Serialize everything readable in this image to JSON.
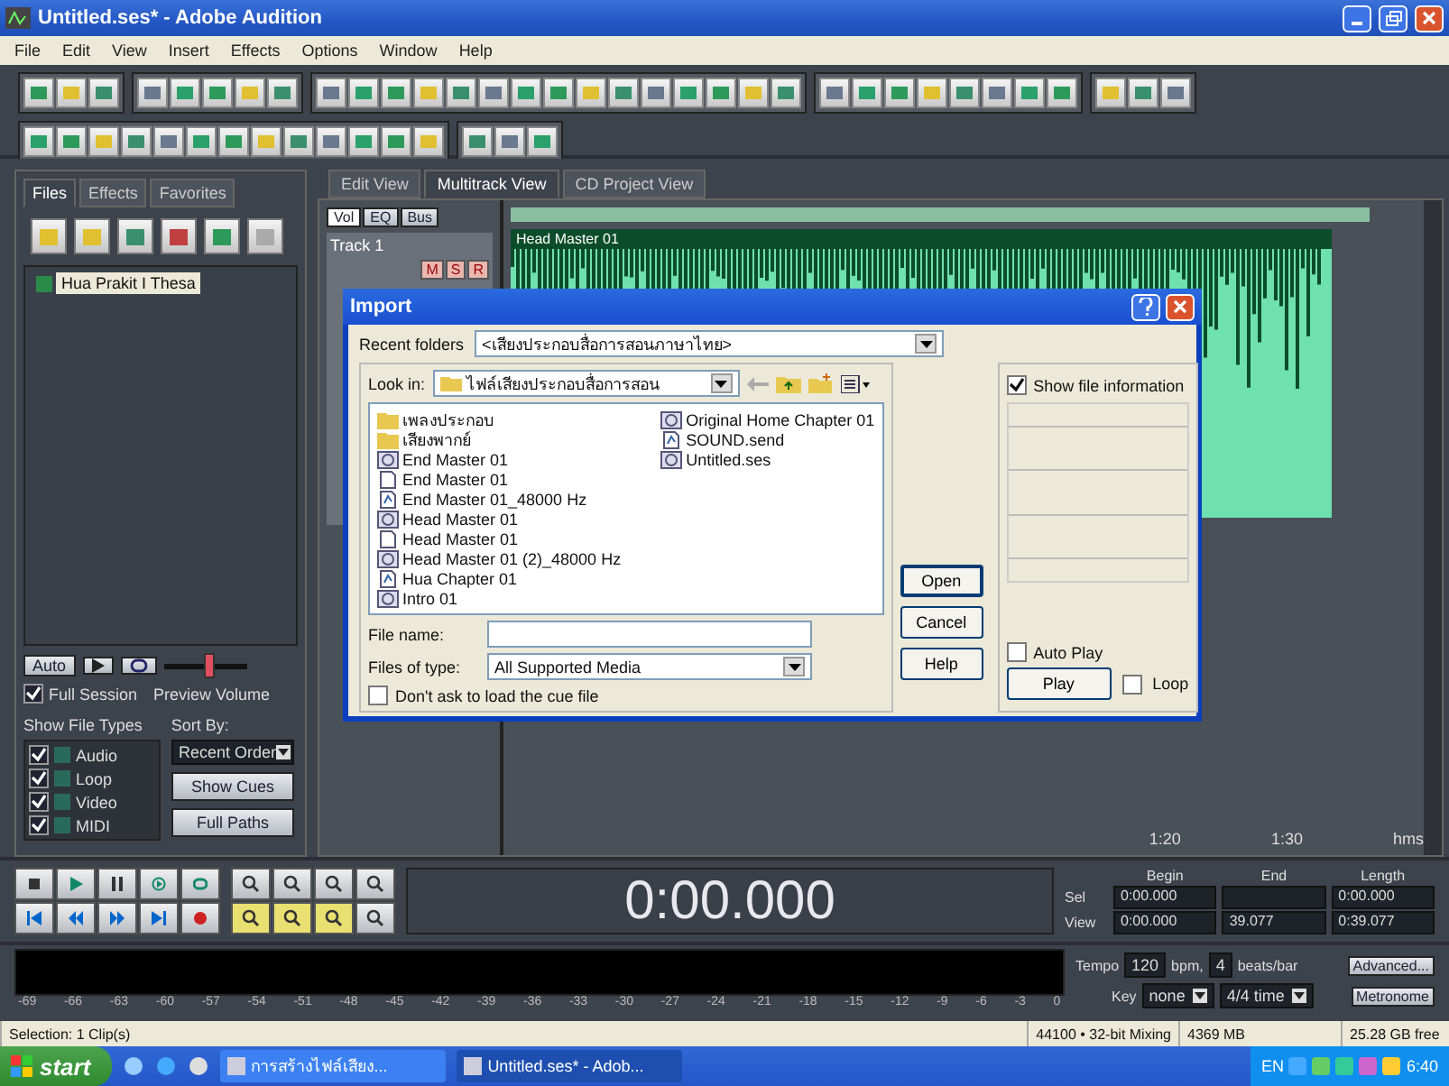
{
  "window": {
    "title": "Untitled.ses* - Adobe Audition"
  },
  "menu": [
    "File",
    "Edit",
    "View",
    "Insert",
    "Effects",
    "Options",
    "Window",
    "Help"
  ],
  "organizer": {
    "tabs": [
      {
        "label": "Files",
        "selected": true
      },
      {
        "label": "Effects",
        "selected": false
      },
      {
        "label": "Favorites",
        "selected": false
      }
    ],
    "files": [
      {
        "label": "Hua Prakit I Thesa",
        "selected": true
      }
    ],
    "auto_play": "Auto",
    "volume": {
      "level": 0.55
    },
    "full_session": {
      "label": "Full Session",
      "checked": true
    },
    "preview_volume": "Preview Volume",
    "show_file_types": "Show File Types",
    "sort_by": "Sort By:",
    "sort_value": "Recent Order",
    "file_types": [
      {
        "label": "Audio",
        "checked": true
      },
      {
        "label": "Loop",
        "checked": true
      },
      {
        "label": "Video",
        "checked": true
      },
      {
        "label": "MIDI",
        "checked": true
      }
    ],
    "buttons": [
      "Show Cues",
      "Full Paths"
    ]
  },
  "view_tabs": [
    {
      "label": "Edit View",
      "selected": false
    },
    {
      "label": "Multitrack View",
      "selected": true
    },
    {
      "label": "CD Project View",
      "selected": false
    }
  ],
  "mixer_tabs": [
    {
      "label": "Vol",
      "selected": true
    },
    {
      "label": "EQ",
      "selected": false
    },
    {
      "label": "Bus",
      "selected": false
    }
  ],
  "track": {
    "name": "Track 1",
    "buttons": [
      "M",
      "S",
      "R"
    ],
    "clip": "Head Master 01"
  },
  "ruler": [
    "1:20",
    "1:30",
    "hms"
  ],
  "dialog": {
    "title": "Import",
    "recent_label": "Recent folders",
    "recent_value": "<เสียงประกอบสื่อการสอนภาษาไทย>",
    "look_in_label": "Look in:",
    "look_in_value": "ไฟล์เสียงประกอบสื่อการสอน",
    "files": [
      {
        "name": "เพลงประกอบ",
        "kind": "folder"
      },
      {
        "name": "เสียงพากย์",
        "kind": "folder"
      },
      {
        "name": "End Master 01",
        "kind": "cd"
      },
      {
        "name": "End Master 01",
        "kind": "file"
      },
      {
        "name": "End Master 01_48000 Hz",
        "kind": "audio"
      },
      {
        "name": "Head Master 01",
        "kind": "cd"
      },
      {
        "name": "Head Master 01",
        "kind": "file"
      },
      {
        "name": "Head Master 01 (2)_48000 Hz",
        "kind": "cd"
      },
      {
        "name": "Hua Chapter 01",
        "kind": "audio"
      },
      {
        "name": "Intro 01",
        "kind": "cd"
      },
      {
        "name": "Original Home Chapter 01",
        "kind": "cd"
      },
      {
        "name": "SOUND.send",
        "kind": "audio"
      },
      {
        "name": "Untitled.ses",
        "kind": "cd"
      }
    ],
    "file_name_label": "File name:",
    "file_type_label": "Files of type:",
    "file_type_value": "All Supported Media",
    "dont_ask": {
      "label": "Don't ask to load the cue file",
      "checked": false
    },
    "buttons": [
      "Open",
      "Cancel",
      "Help"
    ],
    "show_info": {
      "label": "Show file information",
      "checked": true
    },
    "auto_play": {
      "label": "Auto Play",
      "checked": false
    },
    "play": "Play",
    "loop": {
      "label": "Loop",
      "checked": false
    }
  },
  "time": "0:00.000",
  "selection": {
    "columns": [
      "Begin",
      "End",
      "Length"
    ],
    "rows": [
      {
        "label": "Sel",
        "cells": [
          "0:00.000",
          "",
          "0:00.000"
        ]
      },
      {
        "label": "View",
        "cells": [
          "0:00.000",
          "39.077",
          "0:39.077"
        ]
      }
    ]
  },
  "meter_scale": [
    "-69",
    "-66",
    "-63",
    "-60",
    "-57",
    "-54",
    "-51",
    "-48",
    "-45",
    "-42",
    "-39",
    "-36",
    "-33",
    "-30",
    "-27",
    "-24",
    "-21",
    "-18",
    "-15",
    "-12",
    "-9",
    "-6",
    "-3",
    "0"
  ],
  "tempo": {
    "label": "Tempo",
    "value": "120",
    "unit": "bpm,",
    "beats": "4",
    "beats_unit": "beats/bar",
    "advanced": "Advanced...",
    "key_label": "Key",
    "key": "none",
    "time_sig": "4/4 time",
    "metronome": "Metronome"
  },
  "status_bar": [
    "Selection: 1 Clip(s)",
    "44100 • 32-bit Mixing",
    "4369 MB",
    "25.28 GB free"
  ],
  "taskbar": {
    "start": "start",
    "tasks": [
      {
        "label": "การสร้างไฟล์เสียง...",
        "selected": false
      },
      {
        "label": "Untitled.ses* - Adob...",
        "selected": true
      }
    ],
    "lang": "EN",
    "clock": "6:40"
  }
}
